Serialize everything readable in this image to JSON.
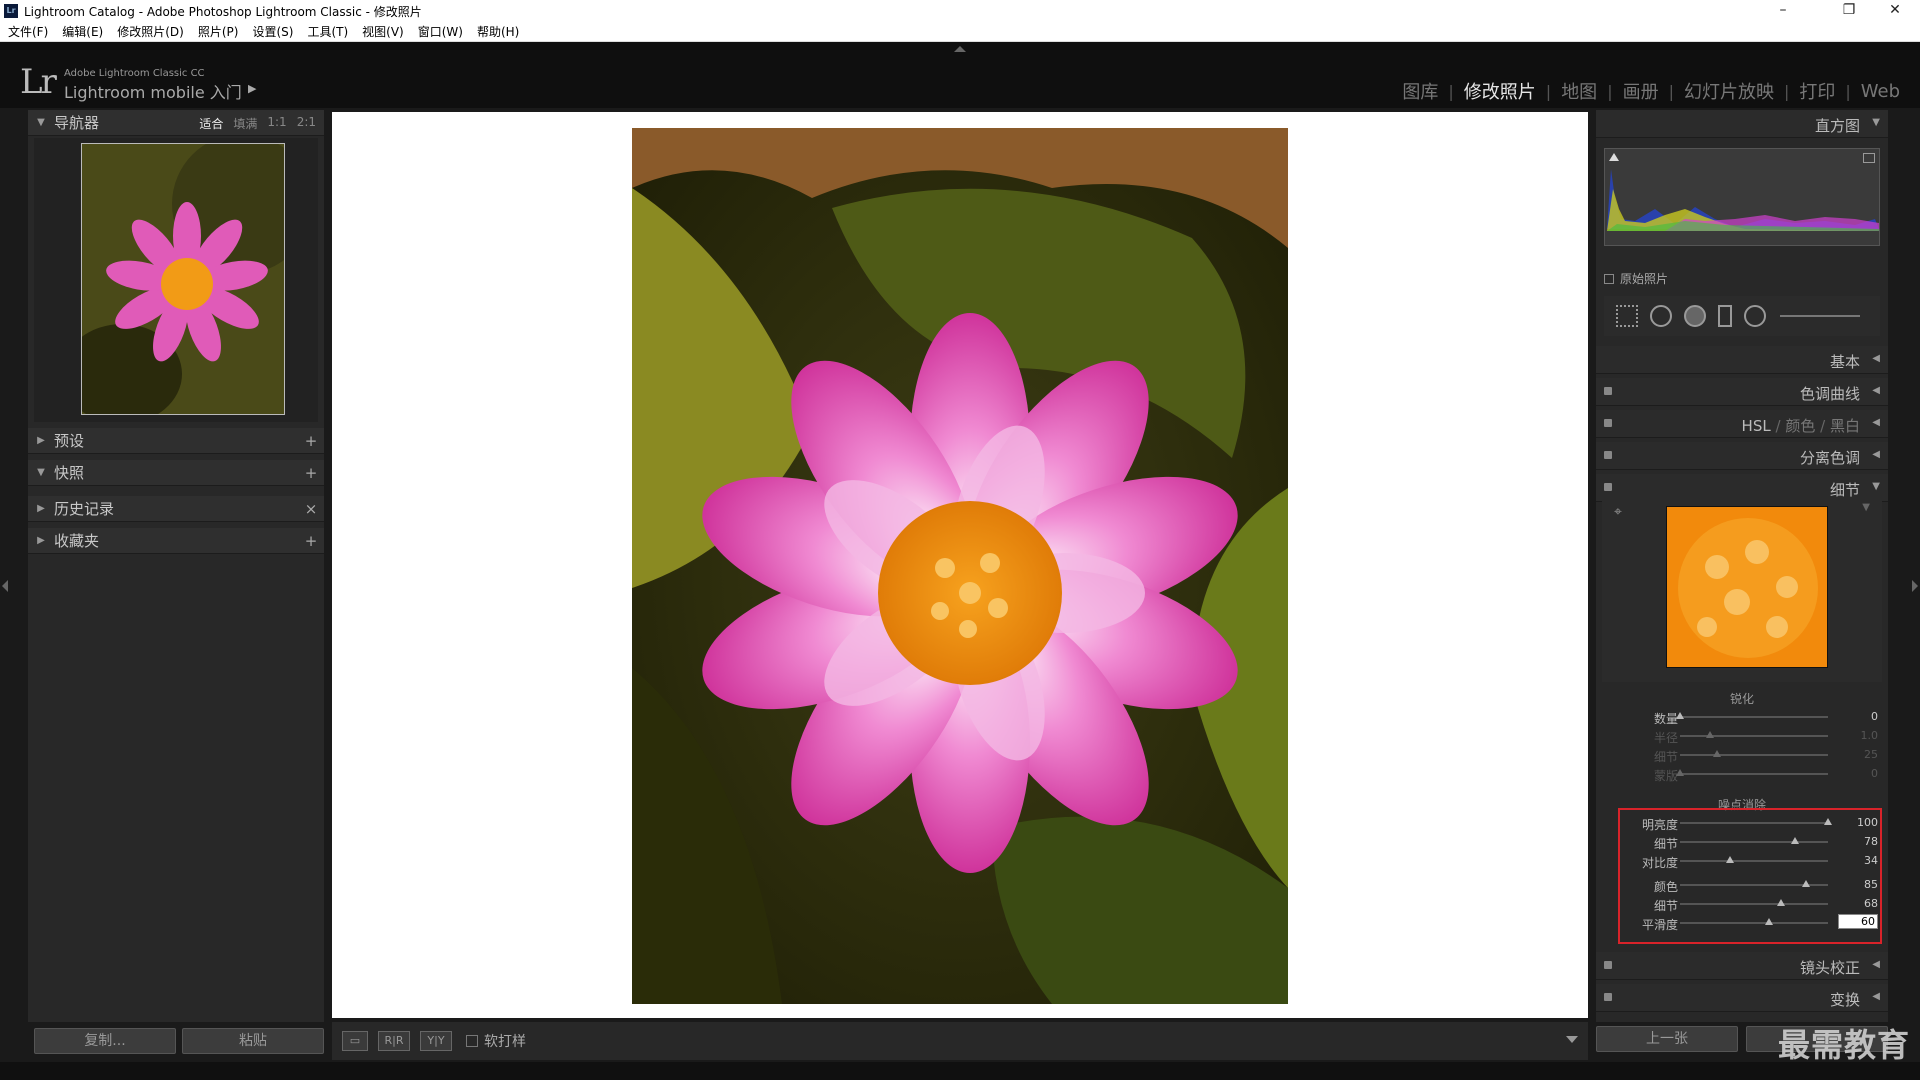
{
  "window": {
    "title": "Lightroom Catalog - Adobe Photoshop Lightroom Classic - 修改照片",
    "app_icon": "Lr",
    "controls": [
      "minimize-icon",
      "restore-icon",
      "close-icon"
    ]
  },
  "menubar": {
    "items": [
      "文件(F)",
      "编辑(E)",
      "修改照片(D)",
      "照片(P)",
      "设置(S)",
      "工具(T)",
      "视图(V)",
      "窗口(W)",
      "帮助(H)"
    ]
  },
  "identity": {
    "logo": "Lr",
    "product": "Adobe Lightroom Classic CC",
    "mobile": "Lightroom mobile 入门",
    "arrow": "▶"
  },
  "modules": {
    "items": [
      "图库",
      "修改照片",
      "地图",
      "画册",
      "幻灯片放映",
      "打印",
      "Web"
    ],
    "active": "修改照片",
    "separator": "|"
  },
  "left_panel": {
    "navigator": {
      "title": "导航器",
      "zoom_options": [
        "适合",
        "填满",
        "1:1",
        "2:1"
      ],
      "zoom_active": "适合"
    },
    "sections": [
      {
        "title": "预设",
        "action": "+"
      },
      {
        "title": "快照",
        "action": "+"
      },
      {
        "title": "历史记录",
        "action": "×"
      },
      {
        "title": "收藏夹",
        "action": "+"
      }
    ],
    "copy_button": "复制...",
    "paste_button": "粘贴"
  },
  "toolbar": {
    "view_buttons": [
      "",
      "R|R",
      "Y|Y"
    ],
    "soft_proof_label": "软打样"
  },
  "right_panel": {
    "histogram_title": "直方图",
    "original_photo": "原始照片",
    "panels": [
      {
        "title": "基本"
      },
      {
        "title": "色调曲线"
      },
      {
        "title": "分离色调"
      },
      {
        "title": "细节"
      },
      {
        "title": "镜头校正"
      },
      {
        "title": "变换"
      }
    ],
    "hsl": {
      "hsl": "HSL",
      "sep": "/",
      "color": "颜色",
      "bw": "黑白"
    },
    "sharpening": {
      "title": "锐化",
      "sliders": [
        {
          "label": "数量",
          "value": "0",
          "pos": 0.0,
          "dim": false
        },
        {
          "label": "半径",
          "value": "1.0",
          "pos": 0.2,
          "dim": true
        },
        {
          "label": "细节",
          "value": "25",
          "pos": 0.25,
          "dim": true
        },
        {
          "label": "蒙版",
          "value": "0",
          "pos": 0.0,
          "dim": true
        }
      ]
    },
    "noise_reduction": {
      "title": "噪点消除",
      "luminance": [
        {
          "label": "明亮度",
          "value": "100",
          "pos": 1.0
        },
        {
          "label": "细节",
          "value": "78",
          "pos": 0.78
        },
        {
          "label": "对比度",
          "value": "34",
          "pos": 0.34
        }
      ],
      "color": [
        {
          "label": "颜色",
          "value": "85",
          "pos": 0.85
        },
        {
          "label": "细节",
          "value": "68",
          "pos": 0.68
        },
        {
          "label": "平滑度",
          "value": "60",
          "pos": 0.6
        }
      ]
    },
    "prev_button": "上一张"
  },
  "watermark": "最需教育",
  "colors": {
    "highlight": "#d9232a",
    "bg": "#1a1a1a",
    "panel": "#282828"
  }
}
